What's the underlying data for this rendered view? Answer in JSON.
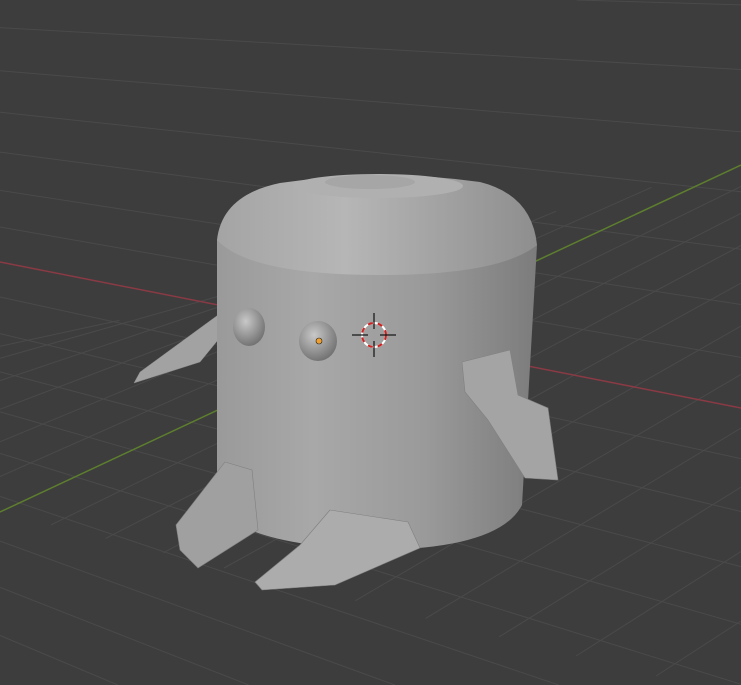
{
  "viewport": {
    "mode": "3d-viewport",
    "colors": {
      "background": "#3d3d3d",
      "grid": "#4a4a4a",
      "x_axis": "#8a3a44",
      "y_axis": "#5d7e2e",
      "mesh_light": "#b4b4b4",
      "mesh_mid": "#9c9c9c",
      "mesh_dark": "#7a7a7a",
      "origin": "#f0a030"
    },
    "icons": [
      "3d-cursor-icon",
      "object-origin-icon"
    ]
  }
}
